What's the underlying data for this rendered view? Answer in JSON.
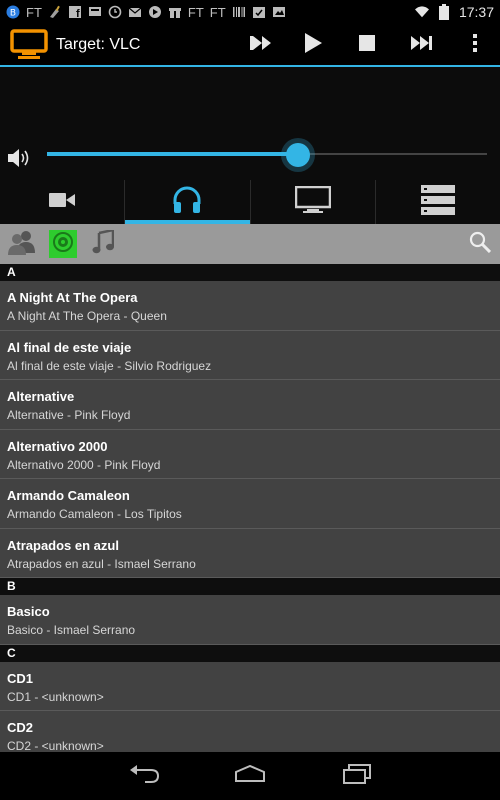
{
  "status_bar": {
    "left_text_1": "FT",
    "left_text_2": "FT",
    "left_text_3": "FT",
    "time": "17:37"
  },
  "action_bar": {
    "title": "Target: VLC"
  },
  "volume": {
    "level": 0.57
  },
  "tabs": [
    {
      "name": "video"
    },
    {
      "name": "audio",
      "active": true
    },
    {
      "name": "tv"
    },
    {
      "name": "list"
    }
  ],
  "list": {
    "sections": [
      {
        "letter": "A",
        "items": [
          {
            "title": "A Night At The Opera",
            "subtitle": "A Night At The Opera - Queen"
          },
          {
            "title": "Al final de este viaje",
            "subtitle": "Al final de este viaje - Silvio Rodriguez"
          },
          {
            "title": "Alternative",
            "subtitle": "Alternative - Pink Floyd"
          },
          {
            "title": "Alternativo 2000",
            "subtitle": "Alternativo 2000 - Pink Floyd"
          },
          {
            "title": "Armando Camaleon",
            "subtitle": "Armando Camaleon - Los Tipitos"
          },
          {
            "title": "Atrapados en azul",
            "subtitle": "Atrapados en azul - Ismael Serrano"
          }
        ]
      },
      {
        "letter": "B",
        "items": [
          {
            "title": "Basico",
            "subtitle": "Basico - Ismael Serrano"
          }
        ]
      },
      {
        "letter": "C",
        "items": [
          {
            "title": "CD1",
            "subtitle": "CD1 - <unknown>"
          },
          {
            "title": "CD2",
            "subtitle": "CD2 - <unknown>"
          }
        ]
      }
    ]
  },
  "colors": {
    "accent": "#33b5e5",
    "app_icon": "#f39200",
    "filter_active": "#2ecc2e"
  }
}
